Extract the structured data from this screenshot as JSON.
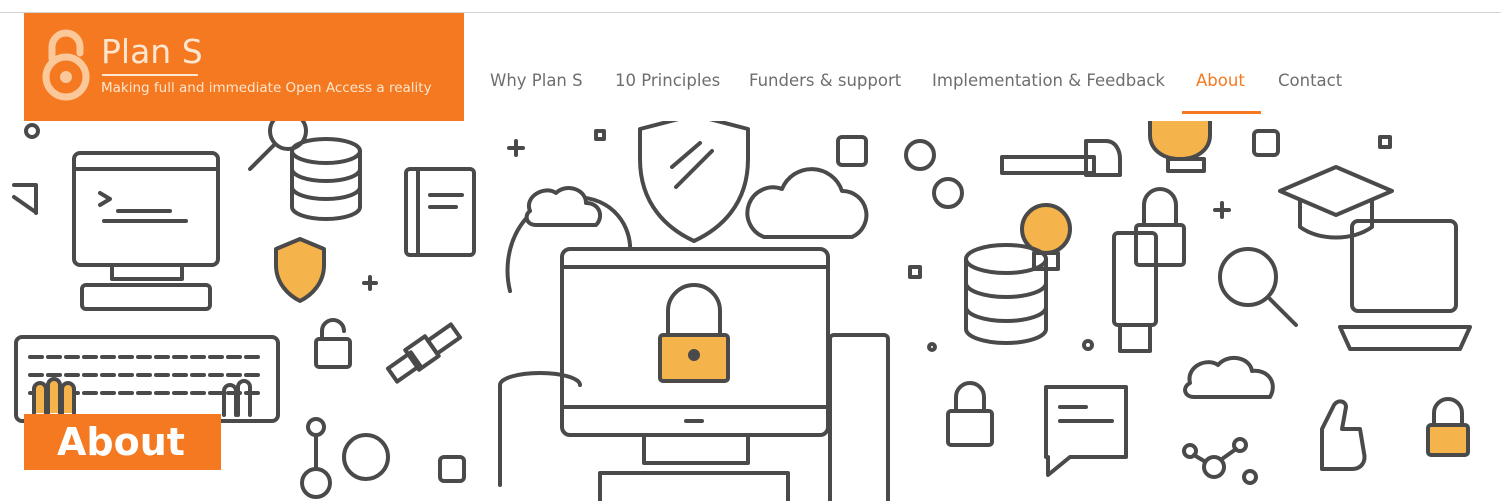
{
  "brand": {
    "title": "Plan S",
    "tagline": "Making full and immediate Open Access a reality",
    "logo_icon": "open-access-lock-icon",
    "color": "#f47920"
  },
  "nav": {
    "items": [
      {
        "label": "Why Plan S"
      },
      {
        "label": "10 Principles"
      },
      {
        "label": "Funders & support"
      },
      {
        "label": "Implementation & Feedback"
      },
      {
        "label": "About"
      },
      {
        "label": "Contact"
      }
    ],
    "active": "About",
    "text_color": "#6e6e6e",
    "active_color": "#f47920"
  },
  "hero": {
    "badge_label": "About",
    "illustration": "open-access-technology-line-icons",
    "line_color": "#4a4a4a",
    "accent_color": "#f5b34c"
  }
}
